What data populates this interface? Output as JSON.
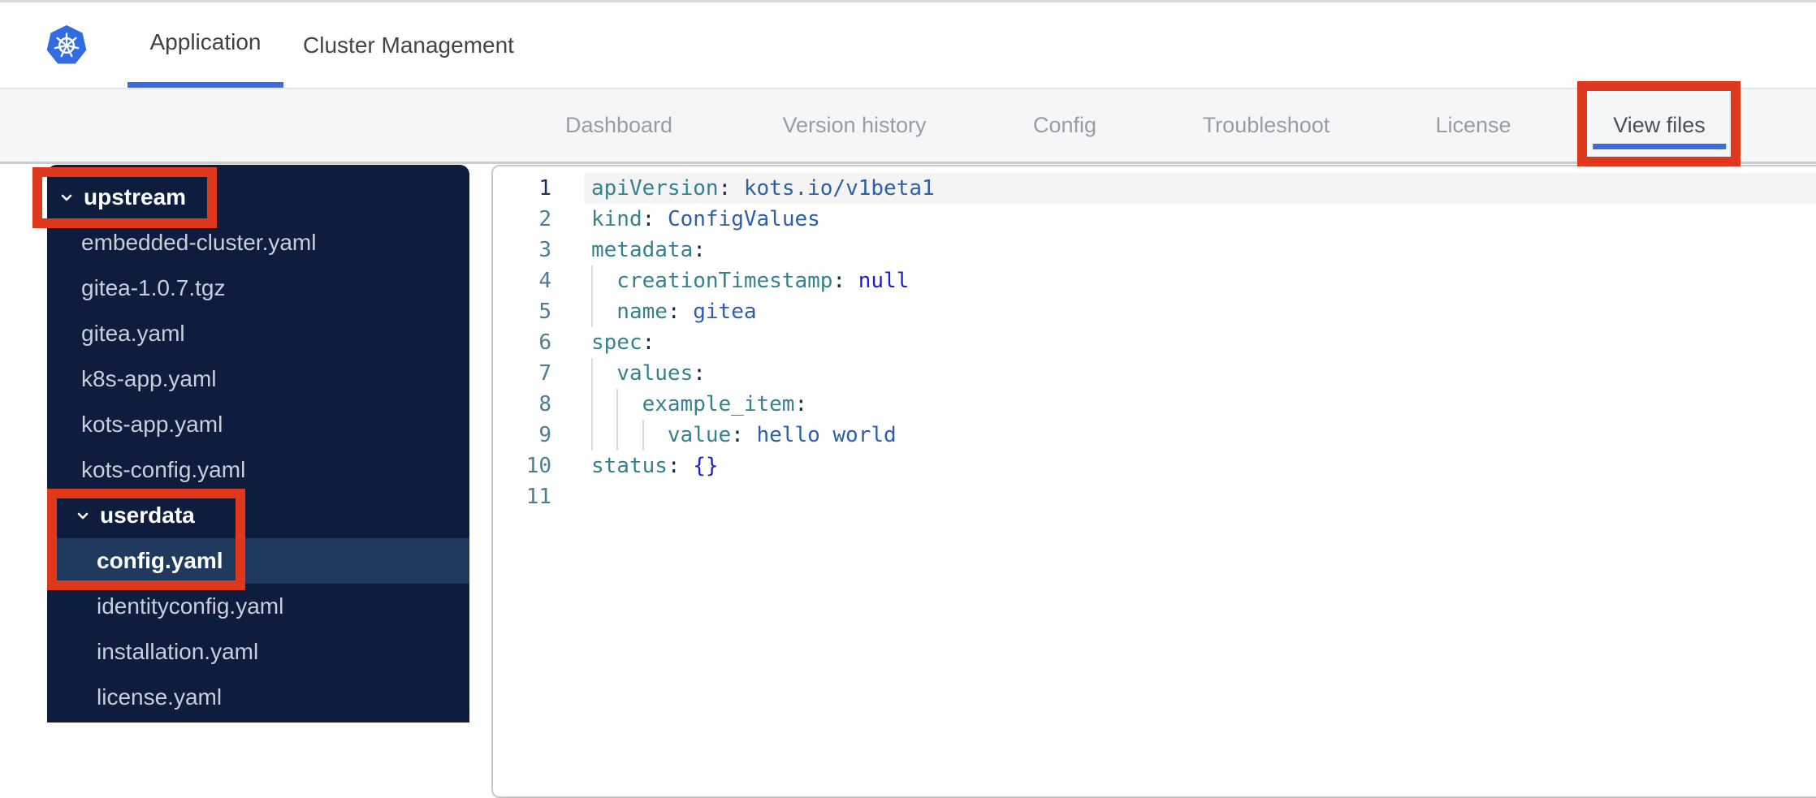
{
  "topbar": {
    "logo": "kubernetes-logo",
    "tabs": [
      {
        "label": "Application",
        "active": true
      },
      {
        "label": "Cluster Management",
        "active": false
      }
    ]
  },
  "subnav": {
    "items": [
      {
        "label": "Dashboard",
        "active": false
      },
      {
        "label": "Version history",
        "active": false
      },
      {
        "label": "Config",
        "active": false
      },
      {
        "label": "Troubleshoot",
        "active": false
      },
      {
        "label": "License",
        "active": false
      },
      {
        "label": "View files",
        "active": true
      }
    ]
  },
  "file_tree": {
    "items": [
      {
        "type": "folder",
        "label": "upstream",
        "level": 0,
        "expanded": true
      },
      {
        "type": "file",
        "label": "embedded-cluster.yaml",
        "level": 1
      },
      {
        "type": "file",
        "label": "gitea-1.0.7.tgz",
        "level": 1
      },
      {
        "type": "file",
        "label": "gitea.yaml",
        "level": 1
      },
      {
        "type": "file",
        "label": "k8s-app.yaml",
        "level": 1
      },
      {
        "type": "file",
        "label": "kots-app.yaml",
        "level": 1
      },
      {
        "type": "file",
        "label": "kots-config.yaml",
        "level": 1
      },
      {
        "type": "folder",
        "label": "userdata",
        "level": 1,
        "expanded": true
      },
      {
        "type": "file",
        "label": "config.yaml",
        "level": 2,
        "selected": true
      },
      {
        "type": "file",
        "label": "identityconfig.yaml",
        "level": 2
      },
      {
        "type": "file",
        "label": "installation.yaml",
        "level": 2
      },
      {
        "type": "file",
        "label": "license.yaml",
        "level": 2
      }
    ]
  },
  "editor": {
    "language": "yaml",
    "active_line": 1,
    "lines": [
      {
        "number": 1,
        "indent": 0,
        "segments": [
          {
            "c": "key",
            "t": "apiVersion"
          },
          {
            "c": "punct",
            "t": ": "
          },
          {
            "c": "val",
            "t": "kots.io/v1beta1"
          }
        ]
      },
      {
        "number": 2,
        "indent": 0,
        "segments": [
          {
            "c": "key",
            "t": "kind"
          },
          {
            "c": "punct",
            "t": ": "
          },
          {
            "c": "val",
            "t": "ConfigValues"
          }
        ]
      },
      {
        "number": 3,
        "indent": 0,
        "segments": [
          {
            "c": "key",
            "t": "metadata"
          },
          {
            "c": "punct",
            "t": ":"
          }
        ]
      },
      {
        "number": 4,
        "indent": 1,
        "segments": [
          {
            "c": "key",
            "t": "creationTimestamp"
          },
          {
            "c": "punct",
            "t": ": "
          },
          {
            "c": "atom",
            "t": "null"
          }
        ]
      },
      {
        "number": 5,
        "indent": 1,
        "segments": [
          {
            "c": "key",
            "t": "name"
          },
          {
            "c": "punct",
            "t": ": "
          },
          {
            "c": "val",
            "t": "gitea"
          }
        ]
      },
      {
        "number": 6,
        "indent": 0,
        "segments": [
          {
            "c": "key",
            "t": "spec"
          },
          {
            "c": "punct",
            "t": ":"
          }
        ]
      },
      {
        "number": 7,
        "indent": 1,
        "segments": [
          {
            "c": "key",
            "t": "values"
          },
          {
            "c": "punct",
            "t": ":"
          }
        ]
      },
      {
        "number": 8,
        "indent": 2,
        "segments": [
          {
            "c": "key",
            "t": "example_item"
          },
          {
            "c": "punct",
            "t": ":"
          }
        ]
      },
      {
        "number": 9,
        "indent": 3,
        "segments": [
          {
            "c": "key",
            "t": "value"
          },
          {
            "c": "punct",
            "t": ": "
          },
          {
            "c": "val",
            "t": "hello world"
          }
        ]
      },
      {
        "number": 10,
        "indent": 0,
        "segments": [
          {
            "c": "key",
            "t": "status"
          },
          {
            "c": "punct",
            "t": ": "
          },
          {
            "c": "atom",
            "t": "{}"
          }
        ]
      },
      {
        "number": 11,
        "indent": 0,
        "segments": []
      }
    ]
  },
  "annotations": {
    "color": "#e0381c",
    "boxes": [
      {
        "target": "view-files-tab"
      },
      {
        "target": "upstream-folder"
      },
      {
        "target": "userdata-config-yaml"
      }
    ]
  },
  "colors": {
    "brand_blue": "#326ce5",
    "tab_underline": "#3b6ce4",
    "sidebar_bg": "#0e1c3e",
    "sidebar_selected_bg": "#20395f",
    "code_key": "#35818f",
    "code_value": "#2c5ea9",
    "code_atom": "#1c1cd8",
    "annotation_red": "#e0381c"
  }
}
